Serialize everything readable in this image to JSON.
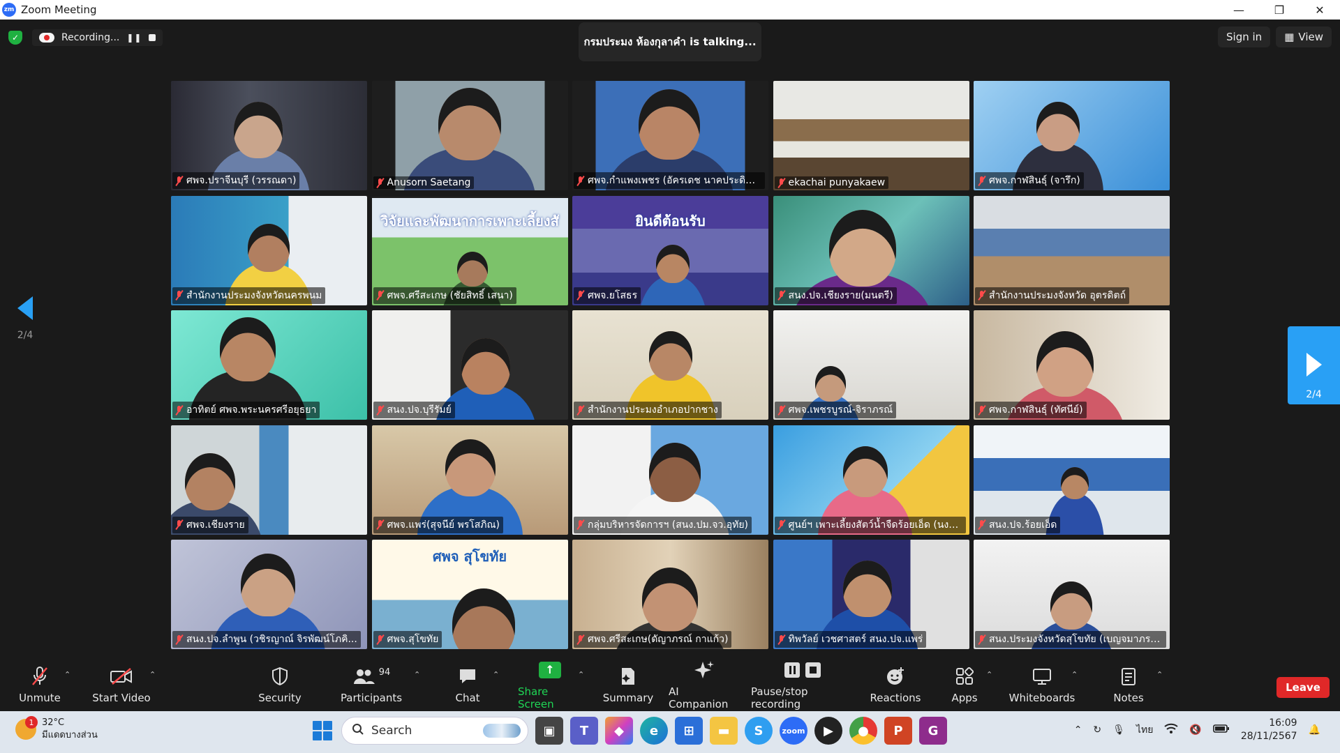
{
  "window": {
    "app_logo": "zm",
    "title": "Zoom Meeting",
    "minimize": "—",
    "restore": "❐",
    "close": "✕"
  },
  "top_bar": {
    "recording_label": "Recording...",
    "speaker_text": "กรมประมง ห้องกุลาคำ is talking...",
    "sign_in": "Sign in",
    "view": "View"
  },
  "participants": [
    {
      "name": "ศพจ.ปราจีนบุรี (วรรณดา)"
    },
    {
      "name": "Anusorn Saetang"
    },
    {
      "name": "ศพจ.กำแพงเพชร (อัครเดช นาคประดิษฐ์ )"
    },
    {
      "name": "ekachai punyakaew"
    },
    {
      "name": "ศพจ.กาฬสินธุ์ (จารึก)"
    },
    {
      "name": "สำนักงานประมงจังหวัดนครพนม"
    },
    {
      "name": "ศพจ.ศรีสะเกษ (ชัยสิทธิ์ เสนา)",
      "banner": "วิจัยและพัฒนาการเพาะเลี้ยงสั"
    },
    {
      "name": "ศพจ.ยโสธร",
      "banner": "ยินดีต้อนรับ"
    },
    {
      "name": "สนง.ปจ.เชียงราย(มนตรี)"
    },
    {
      "name": "สำนักงานประมงจังหวัด อุตรดิตถ์"
    },
    {
      "name": "อาทิตย์ ศพจ.พระนครศรีอยุธยา"
    },
    {
      "name": "สนง.ปจ.บุรีรัมย์"
    },
    {
      "name": "สำนักงานประมงอำเภอปากชาง"
    },
    {
      "name": "ศพจ.เพชรบูรณ์-จิราภรณ์"
    },
    {
      "name": "ศพจ.กาฬสินธุ์ (ทัศนีย์)"
    },
    {
      "name": "ศพจ.เชียงราย"
    },
    {
      "name": "ศพจ.แพร่(สุจนีย์ พรโสภิณ)"
    },
    {
      "name": "กลุ่มบริหารจัดการฯ (สนง.ปม.จว.อุทัย)"
    },
    {
      "name": "ศูนย์ฯ เพาะเลี้ยงสัตว์น้ำจืดร้อยเอ็ด (นงนุช)"
    },
    {
      "name": "สนง.ปจ.ร้อยเอ็ด"
    },
    {
      "name": "สนง.ปจ.ลำพูน (วชิรญาณ์ จิรพัฒน์โภคิ..."
    },
    {
      "name": "ศพจ.สุโขทัย",
      "banner": "ศพจ สุโขทัย"
    },
    {
      "name": "ศพจ.ศรีสะเกษ(ดัญาภรณ์ กาแก้ว)"
    },
    {
      "name": "ทิพวัลย์ เวชศาสตร์ สนง.ปจ.แพร่"
    },
    {
      "name": "สนง.ประมงจังหวัดสุโขทัย (เบญจมาภรณ์ ..."
    }
  ],
  "pager": {
    "prev_page": "2/4",
    "next_page": "2/4"
  },
  "toolbar": {
    "unmute": "Unmute",
    "start_video": "Start Video",
    "security": "Security",
    "participants": "Participants",
    "participant_count": "94",
    "chat": "Chat",
    "share_screen": "Share Screen",
    "summary": "Summary",
    "ai_companion": "AI Companion",
    "pause_recording": "Pause/stop recording",
    "reactions": "Reactions",
    "apps": "Apps",
    "whiteboards": "Whiteboards",
    "notes": "Notes",
    "leave": "Leave"
  },
  "taskbar": {
    "weather_badge": "1",
    "temperature": "32°C",
    "weather_desc": "มีแดดบางส่วน",
    "search": "Search",
    "language": "ไทย",
    "time": "16:09",
    "date": "28/11/2567"
  },
  "colors": {
    "accent_blue": "#29a0f5",
    "share_green": "#1fb141",
    "leave_red": "#e02828",
    "muted_red": "#ff4b4b"
  }
}
